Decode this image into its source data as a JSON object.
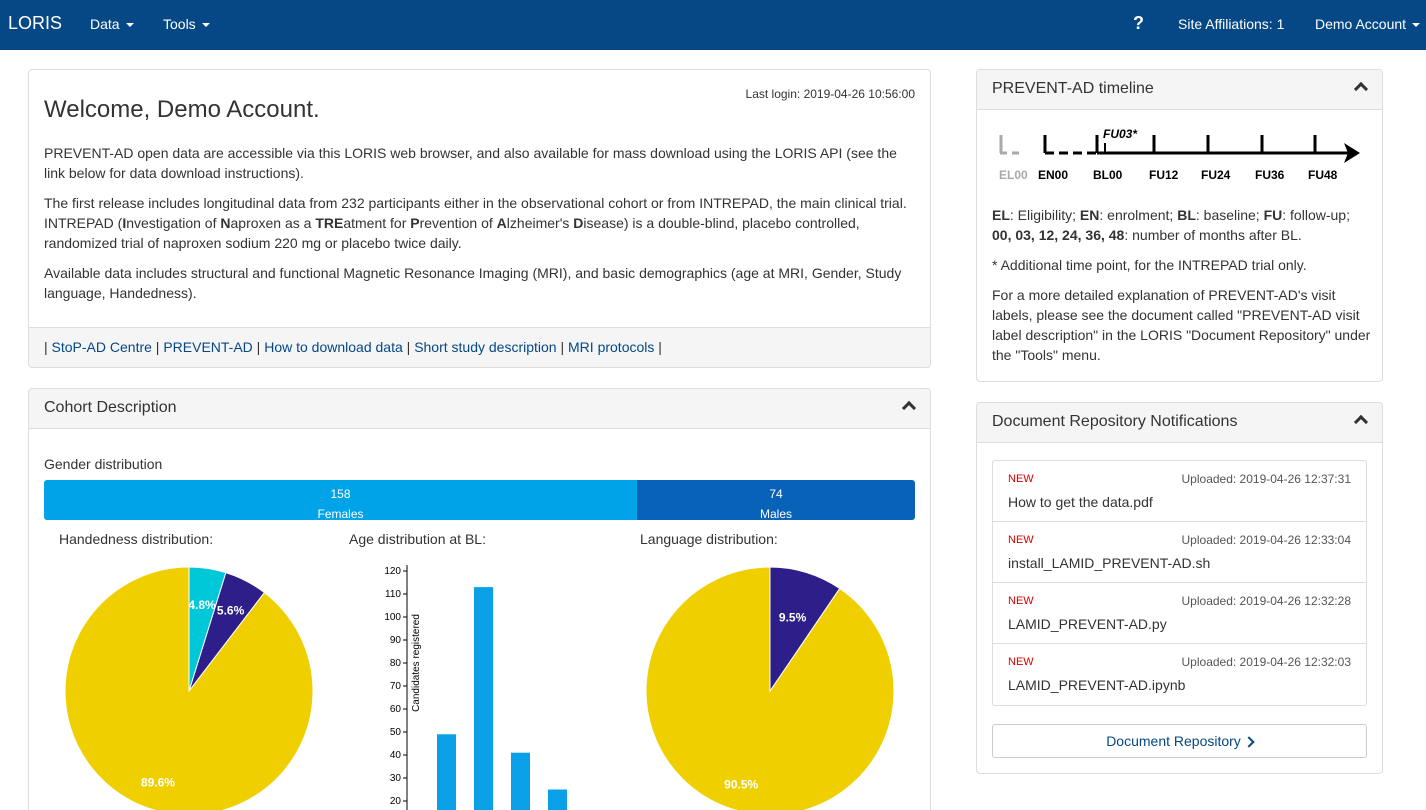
{
  "navbar": {
    "brand": "LORIS",
    "menu_data": "Data",
    "menu_tools": "Tools",
    "help": "?",
    "site": "Site Affiliations: 1",
    "account": "Demo Account"
  },
  "welcome": {
    "title": "Welcome, Demo Account.",
    "last_login": "Last login: 2019-04-26 10:56:00",
    "p1": "PREVENT-AD open data are accessible via this LORIS web browser, and also available for mass download using the LORIS API (see the link below for data download instructions).",
    "p2a": "The first release includes longitudinal data from 232 participants either in the observational cohort or from INTREPAD, the main clinical trial. INTREPAD (",
    "p3": "Available data includes structural and functional Magnetic Resonance Imaging (MRI), and basic demographics (age at MRI, Gender, Study language, Handedness).",
    "links": [
      "StoP-AD Centre",
      "PREVENT-AD",
      "How to download data",
      "Short study description",
      "MRI protocols"
    ]
  },
  "cohort": {
    "title": "Cohort Description",
    "gender_label": "Gender distribution",
    "females_count": "158",
    "females_label": "Females",
    "males_count": "74",
    "males_label": "Males",
    "handedness_title": "Handedness distribution:",
    "age_title": "Age distribution at BL:",
    "language_title": "Language distribution:"
  },
  "chart_data": [
    {
      "type": "pie",
      "title": "Handedness distribution:",
      "values": [
        89.6,
        5.6,
        4.8
      ],
      "labels": [
        "89.6%",
        "5.6%",
        "4.8%"
      ],
      "colors": [
        "#f0cf00",
        "#2e1e89",
        "#00c8d8"
      ]
    },
    {
      "type": "bar",
      "title": "Age distribution at BL:",
      "ylabel": "Candidates registered",
      "yticks": [
        "20",
        "30",
        "40",
        "50",
        "60",
        "70",
        "80",
        "90",
        "100",
        "110",
        "120"
      ],
      "values": [
        49,
        113,
        41,
        25
      ],
      "ylim": [
        20,
        120
      ],
      "color": "#0aa0e8"
    },
    {
      "type": "pie",
      "title": "Language distribution:",
      "values": [
        90.5,
        9.5
      ],
      "labels": [
        "90.5%",
        "9.5%"
      ],
      "colors": [
        "#f0cf00",
        "#2e1e89"
      ]
    }
  ],
  "timeline": {
    "title": "PREVENT-AD timeline",
    "fu03": "FU03*",
    "labels": [
      "EL00",
      "EN00",
      "BL00",
      "FU12",
      "FU24",
      "FU36",
      "FU48"
    ],
    "legend_a": ": Eligibility; ",
    "legend_b": ": enrolment; ",
    "legend_c": ": baseline; ",
    "legend_d": ": follow-up;",
    "legend_e": ": number of months after BL.",
    "note": "* Additional time point, for the INTREPAD trial only.",
    "detail": "For a more detailed explanation of PREVENT-AD's visit labels, please see the document called \"PREVENT-AD visit label description\" in the LORIS \"Document Repository\" under the \"Tools\" menu."
  },
  "docs": {
    "title": "Document Repository Notifications",
    "new_label": "NEW",
    "items": [
      {
        "uploaded": "Uploaded: 2019-04-26 12:37:31",
        "name": "How to get the data.pdf"
      },
      {
        "uploaded": "Uploaded: 2019-04-26 12:33:04",
        "name": "install_LAMID_PREVENT-AD.sh"
      },
      {
        "uploaded": "Uploaded: 2019-04-26 12:32:28",
        "name": "LAMID_PREVENT-AD.py"
      },
      {
        "uploaded": "Uploaded: 2019-04-26 12:32:03",
        "name": "LAMID_PREVENT-AD.ipynb"
      }
    ],
    "button": "Document Repository"
  }
}
